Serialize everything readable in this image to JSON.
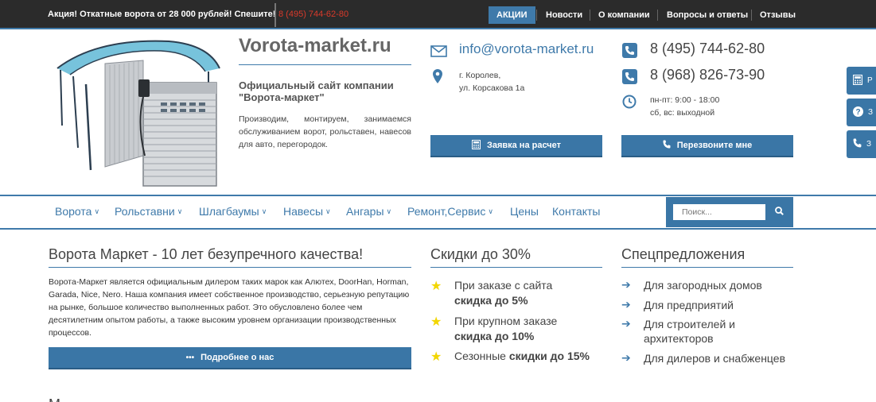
{
  "topbar": {
    "promo_bold": "Акция!",
    "promo_text": " Откатные ворота от 28 000 рублей! Спешите!",
    "promo_phone": "8 (495) 744-62-80",
    "nav": [
      {
        "label": "АКЦИИ",
        "active": true
      },
      {
        "label": "Новости"
      },
      {
        "label": "О компании"
      },
      {
        "label": "Вопросы и ответы"
      },
      {
        "label": "Отзывы"
      }
    ]
  },
  "header": {
    "site_title": "Vorota-market.ru",
    "subtitle": "Официальный сайт компании \"Ворота-маркет\"",
    "description": "Производим, монтируем, занимаемся обслуживанием ворот, рольставен, навесов для авто, перегородок.",
    "email": "info@vorota-market.ru",
    "address_line1": "г. Королев,",
    "address_line2": "ул. Корсакова 1а",
    "phone1": "8 (495) 744-62-80",
    "phone2": "8 (968) 826-73-90",
    "hours_line1": "пн-пт: 9:00 - 18:00",
    "hours_line2": "сб, вс: выходной",
    "request_button": "Заявка на расчет",
    "callback_button": "Перезвоните мне"
  },
  "side_tabs": [
    {
      "icon": "calculator-icon",
      "text": "Р"
    },
    {
      "icon": "question-icon",
      "text": "З"
    },
    {
      "icon": "phone-icon",
      "text": "З"
    }
  ],
  "nav": {
    "items": [
      {
        "label": "Ворота",
        "dropdown": true
      },
      {
        "label": "Рольставни",
        "dropdown": true
      },
      {
        "label": "Шлагбаумы",
        "dropdown": true
      },
      {
        "label": "Навесы",
        "dropdown": true
      },
      {
        "label": "Ангары",
        "dropdown": true
      },
      {
        "label": "Ремонт,Сервис",
        "dropdown": true
      },
      {
        "label": "Цены",
        "dropdown": false
      },
      {
        "label": "Контакты",
        "dropdown": false
      }
    ],
    "search_placeholder": "Поиск..."
  },
  "about": {
    "title": "Ворота Маркет - 10 лет безупречного качества!",
    "text": "Ворота-Маркет является официальным дилером таких марок как Алютех, DoorHan, Horman, Garada, Nice, Nero. Наша компания имеет собственное производство, серьезную репутацию на рынке, большое количество выполненных работ. Это обусловлено более чем десятилетним опытом работы, а также высоким уровнем организации производственных процессов.",
    "button": "Подробнее о нас"
  },
  "discounts": {
    "title": "Скидки до 30%",
    "items": [
      {
        "text": "При заказе с сайта",
        "bold": "скидка до 5%"
      },
      {
        "text": "При крупном заказе",
        "bold": "скидка до 10%"
      },
      {
        "text": "Сезонные",
        "bold": "скидки до 15%"
      }
    ]
  },
  "offers": {
    "title": "Спецпредложения",
    "items": [
      "Для загородных домов",
      "Для предприятий",
      "Для строителей и архитекторов",
      "Для дилеров и снабженцев"
    ]
  },
  "next_section_stub": "М",
  "colors": {
    "brand_blue": "#3a76a6",
    "topbar_bg": "#2b2b2b",
    "promo_red": "#d93a2b",
    "star_yellow": "#f2d600"
  }
}
